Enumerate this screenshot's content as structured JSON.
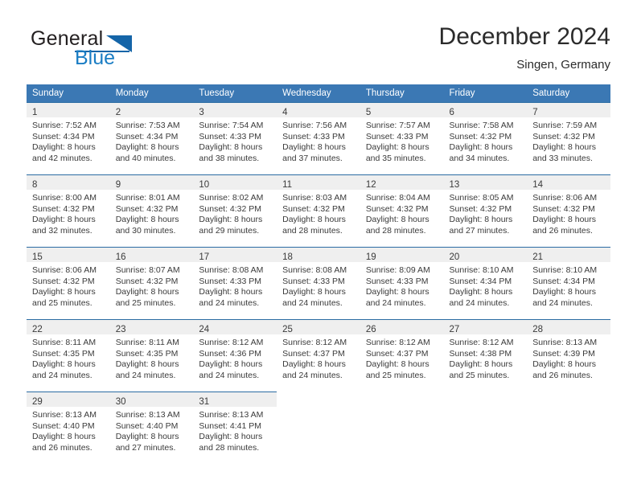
{
  "brand": {
    "name_part1": "General",
    "name_part2": "Blue",
    "logo_icon": "triangle-icon"
  },
  "header": {
    "month_title": "December 2024",
    "location": "Singen, Germany"
  },
  "colors": {
    "header_blue": "#3b78b4",
    "cell_divider_blue": "#2b6ca3",
    "daynum_background": "#efefef",
    "brand_blue": "#1a7dc4"
  },
  "calendar": {
    "weekday_headers": [
      "Sunday",
      "Monday",
      "Tuesday",
      "Wednesday",
      "Thursday",
      "Friday",
      "Saturday"
    ],
    "weeks": [
      [
        {
          "day": "1",
          "sunrise": "Sunrise: 7:52 AM",
          "sunset": "Sunset: 4:34 PM",
          "daylight_line1": "Daylight: 8 hours",
          "daylight_line2": "and 42 minutes."
        },
        {
          "day": "2",
          "sunrise": "Sunrise: 7:53 AM",
          "sunset": "Sunset: 4:34 PM",
          "daylight_line1": "Daylight: 8 hours",
          "daylight_line2": "and 40 minutes."
        },
        {
          "day": "3",
          "sunrise": "Sunrise: 7:54 AM",
          "sunset": "Sunset: 4:33 PM",
          "daylight_line1": "Daylight: 8 hours",
          "daylight_line2": "and 38 minutes."
        },
        {
          "day": "4",
          "sunrise": "Sunrise: 7:56 AM",
          "sunset": "Sunset: 4:33 PM",
          "daylight_line1": "Daylight: 8 hours",
          "daylight_line2": "and 37 minutes."
        },
        {
          "day": "5",
          "sunrise": "Sunrise: 7:57 AM",
          "sunset": "Sunset: 4:33 PM",
          "daylight_line1": "Daylight: 8 hours",
          "daylight_line2": "and 35 minutes."
        },
        {
          "day": "6",
          "sunrise": "Sunrise: 7:58 AM",
          "sunset": "Sunset: 4:32 PM",
          "daylight_line1": "Daylight: 8 hours",
          "daylight_line2": "and 34 minutes."
        },
        {
          "day": "7",
          "sunrise": "Sunrise: 7:59 AM",
          "sunset": "Sunset: 4:32 PM",
          "daylight_line1": "Daylight: 8 hours",
          "daylight_line2": "and 33 minutes."
        }
      ],
      [
        {
          "day": "8",
          "sunrise": "Sunrise: 8:00 AM",
          "sunset": "Sunset: 4:32 PM",
          "daylight_line1": "Daylight: 8 hours",
          "daylight_line2": "and 32 minutes."
        },
        {
          "day": "9",
          "sunrise": "Sunrise: 8:01 AM",
          "sunset": "Sunset: 4:32 PM",
          "daylight_line1": "Daylight: 8 hours",
          "daylight_line2": "and 30 minutes."
        },
        {
          "day": "10",
          "sunrise": "Sunrise: 8:02 AM",
          "sunset": "Sunset: 4:32 PM",
          "daylight_line1": "Daylight: 8 hours",
          "daylight_line2": "and 29 minutes."
        },
        {
          "day": "11",
          "sunrise": "Sunrise: 8:03 AM",
          "sunset": "Sunset: 4:32 PM",
          "daylight_line1": "Daylight: 8 hours",
          "daylight_line2": "and 28 minutes."
        },
        {
          "day": "12",
          "sunrise": "Sunrise: 8:04 AM",
          "sunset": "Sunset: 4:32 PM",
          "daylight_line1": "Daylight: 8 hours",
          "daylight_line2": "and 28 minutes."
        },
        {
          "day": "13",
          "sunrise": "Sunrise: 8:05 AM",
          "sunset": "Sunset: 4:32 PM",
          "daylight_line1": "Daylight: 8 hours",
          "daylight_line2": "and 27 minutes."
        },
        {
          "day": "14",
          "sunrise": "Sunrise: 8:06 AM",
          "sunset": "Sunset: 4:32 PM",
          "daylight_line1": "Daylight: 8 hours",
          "daylight_line2": "and 26 minutes."
        }
      ],
      [
        {
          "day": "15",
          "sunrise": "Sunrise: 8:06 AM",
          "sunset": "Sunset: 4:32 PM",
          "daylight_line1": "Daylight: 8 hours",
          "daylight_line2": "and 25 minutes."
        },
        {
          "day": "16",
          "sunrise": "Sunrise: 8:07 AM",
          "sunset": "Sunset: 4:32 PM",
          "daylight_line1": "Daylight: 8 hours",
          "daylight_line2": "and 25 minutes."
        },
        {
          "day": "17",
          "sunrise": "Sunrise: 8:08 AM",
          "sunset": "Sunset: 4:33 PM",
          "daylight_line1": "Daylight: 8 hours",
          "daylight_line2": "and 24 minutes."
        },
        {
          "day": "18",
          "sunrise": "Sunrise: 8:08 AM",
          "sunset": "Sunset: 4:33 PM",
          "daylight_line1": "Daylight: 8 hours",
          "daylight_line2": "and 24 minutes."
        },
        {
          "day": "19",
          "sunrise": "Sunrise: 8:09 AM",
          "sunset": "Sunset: 4:33 PM",
          "daylight_line1": "Daylight: 8 hours",
          "daylight_line2": "and 24 minutes."
        },
        {
          "day": "20",
          "sunrise": "Sunrise: 8:10 AM",
          "sunset": "Sunset: 4:34 PM",
          "daylight_line1": "Daylight: 8 hours",
          "daylight_line2": "and 24 minutes."
        },
        {
          "day": "21",
          "sunrise": "Sunrise: 8:10 AM",
          "sunset": "Sunset: 4:34 PM",
          "daylight_line1": "Daylight: 8 hours",
          "daylight_line2": "and 24 minutes."
        }
      ],
      [
        {
          "day": "22",
          "sunrise": "Sunrise: 8:11 AM",
          "sunset": "Sunset: 4:35 PM",
          "daylight_line1": "Daylight: 8 hours",
          "daylight_line2": "and 24 minutes."
        },
        {
          "day": "23",
          "sunrise": "Sunrise: 8:11 AM",
          "sunset": "Sunset: 4:35 PM",
          "daylight_line1": "Daylight: 8 hours",
          "daylight_line2": "and 24 minutes."
        },
        {
          "day": "24",
          "sunrise": "Sunrise: 8:12 AM",
          "sunset": "Sunset: 4:36 PM",
          "daylight_line1": "Daylight: 8 hours",
          "daylight_line2": "and 24 minutes."
        },
        {
          "day": "25",
          "sunrise": "Sunrise: 8:12 AM",
          "sunset": "Sunset: 4:37 PM",
          "daylight_line1": "Daylight: 8 hours",
          "daylight_line2": "and 24 minutes."
        },
        {
          "day": "26",
          "sunrise": "Sunrise: 8:12 AM",
          "sunset": "Sunset: 4:37 PM",
          "daylight_line1": "Daylight: 8 hours",
          "daylight_line2": "and 25 minutes."
        },
        {
          "day": "27",
          "sunrise": "Sunrise: 8:12 AM",
          "sunset": "Sunset: 4:38 PM",
          "daylight_line1": "Daylight: 8 hours",
          "daylight_line2": "and 25 minutes."
        },
        {
          "day": "28",
          "sunrise": "Sunrise: 8:13 AM",
          "sunset": "Sunset: 4:39 PM",
          "daylight_line1": "Daylight: 8 hours",
          "daylight_line2": "and 26 minutes."
        }
      ],
      [
        {
          "day": "29",
          "sunrise": "Sunrise: 8:13 AM",
          "sunset": "Sunset: 4:40 PM",
          "daylight_line1": "Daylight: 8 hours",
          "daylight_line2": "and 26 minutes."
        },
        {
          "day": "30",
          "sunrise": "Sunrise: 8:13 AM",
          "sunset": "Sunset: 4:40 PM",
          "daylight_line1": "Daylight: 8 hours",
          "daylight_line2": "and 27 minutes."
        },
        {
          "day": "31",
          "sunrise": "Sunrise: 8:13 AM",
          "sunset": "Sunset: 4:41 PM",
          "daylight_line1": "Daylight: 8 hours",
          "daylight_line2": "and 28 minutes."
        },
        {
          "day": "",
          "sunrise": "",
          "sunset": "",
          "daylight_line1": "",
          "daylight_line2": ""
        },
        {
          "day": "",
          "sunrise": "",
          "sunset": "",
          "daylight_line1": "",
          "daylight_line2": ""
        },
        {
          "day": "",
          "sunrise": "",
          "sunset": "",
          "daylight_line1": "",
          "daylight_line2": ""
        },
        {
          "day": "",
          "sunrise": "",
          "sunset": "",
          "daylight_line1": "",
          "daylight_line2": ""
        }
      ]
    ]
  }
}
